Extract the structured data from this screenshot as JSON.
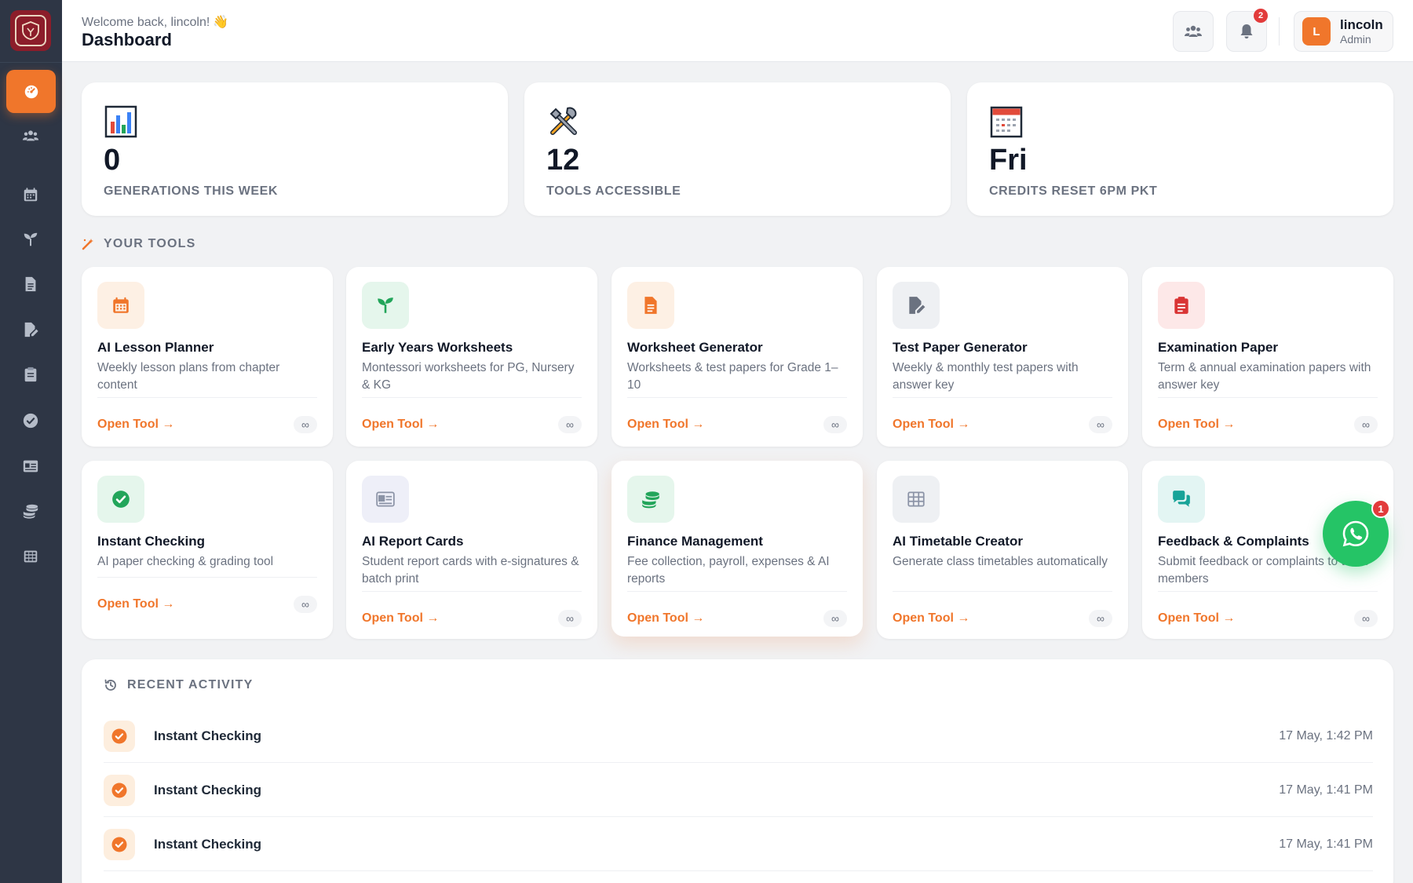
{
  "header": {
    "welcome": "Welcome back, lincoln!",
    "wave_emoji": "👋",
    "title": "Dashboard",
    "notifications_count": "2",
    "user": {
      "initial": "L",
      "name": "lincoln",
      "role": "Admin"
    }
  },
  "sidebar": {
    "items": [
      {
        "icon": "dashboard-icon",
        "active": true
      },
      {
        "icon": "users-icon"
      },
      {
        "icon": "calendar-icon"
      },
      {
        "icon": "sprout-icon"
      },
      {
        "icon": "file-icon"
      },
      {
        "icon": "file-edit-icon"
      },
      {
        "icon": "clipboard-icon"
      },
      {
        "icon": "check-circle-icon"
      },
      {
        "icon": "id-card-icon"
      },
      {
        "icon": "coins-icon"
      },
      {
        "icon": "grid-icon"
      }
    ]
  },
  "stats": [
    {
      "value": "0",
      "label": "GENERATIONS THIS WEEK",
      "icon": "bar-chart-icon"
    },
    {
      "value": "12",
      "label": "TOOLS ACCESSIBLE",
      "icon": "tools-icon"
    },
    {
      "value": "Fri",
      "label": "CREDITS RESET 6PM PKT",
      "icon": "calendar-icon"
    }
  ],
  "tools_section": {
    "title": "YOUR TOOLS"
  },
  "tools": [
    {
      "name": "AI Lesson Planner",
      "desc": "Weekly lesson plans from chapter content",
      "icon": "calendar-icon",
      "color": "#f0762b",
      "bg": "#fdf0e4"
    },
    {
      "name": "Early Years Worksheets",
      "desc": "Montessori worksheets for PG, Nursery & KG",
      "icon": "sprout-icon",
      "color": "#22a55a",
      "bg": "#e5f6ec"
    },
    {
      "name": "Worksheet Generator",
      "desc": "Worksheets & test papers for Grade 1–10",
      "icon": "file-icon",
      "color": "#f0762b",
      "bg": "#fdf0e4"
    },
    {
      "name": "Test Paper Generator",
      "desc": "Weekly & monthly test papers with answer key",
      "icon": "file-edit-icon",
      "color": "#6b7280",
      "bg": "#eef0f3"
    },
    {
      "name": "Examination Paper",
      "desc": "Term & annual examination papers with answer key",
      "icon": "clipboard-icon",
      "color": "#d93434",
      "bg": "#fde8e8"
    },
    {
      "name": "Instant Checking",
      "desc": "AI paper checking & grading tool",
      "icon": "check-circle-icon",
      "color": "#22a55a",
      "bg": "#e5f6ec"
    },
    {
      "name": "AI Report Cards",
      "desc": "Student report cards with e-signatures & batch print",
      "icon": "id-card-icon",
      "color": "#8b93a6",
      "bg": "#eeeff8"
    },
    {
      "name": "Finance Management",
      "desc": "Fee collection, payroll, expenses & AI reports",
      "icon": "coins-icon",
      "color": "#22a55a",
      "bg": "#e5f6ec"
    },
    {
      "name": "AI Timetable Creator",
      "desc": "Generate class timetables automatically",
      "icon": "grid-icon",
      "color": "#8b93a6",
      "bg": "#eef0f3"
    },
    {
      "name": "Feedback & Complaints",
      "desc": "Submit feedback or complaints to team members",
      "icon": "chat-icon",
      "color": "#17a398",
      "bg": "#e3f5f3"
    }
  ],
  "open_tool_label": "Open Tool →",
  "unlimited_label": "∞",
  "whatsapp": {
    "badge": "1"
  },
  "activity": {
    "title": "RECENT ACTIVITY",
    "rows": [
      {
        "name": "Instant Checking",
        "time": "17 May, 1:42 PM"
      },
      {
        "name": "Instant Checking",
        "time": "17 May, 1:41 PM"
      },
      {
        "name": "Instant Checking",
        "time": "17 May, 1:41 PM"
      }
    ]
  }
}
